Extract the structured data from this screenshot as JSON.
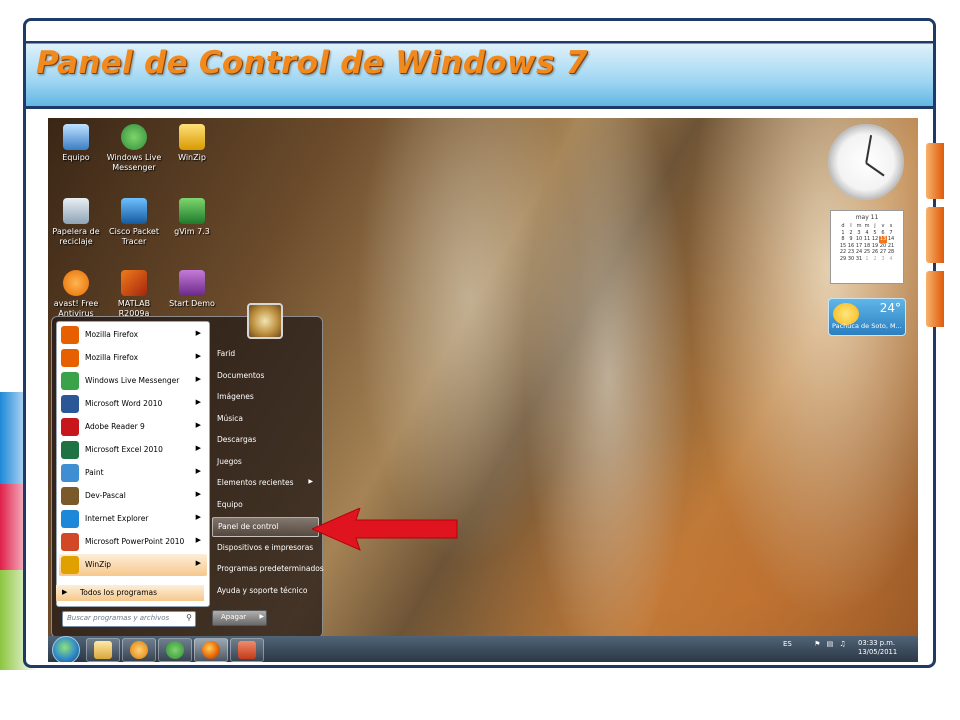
{
  "slide": {
    "title": "Panel de Control de Windows 7"
  },
  "desktop_icons": [
    {
      "label": "Equipo"
    },
    {
      "label": "Windows Live Messenger"
    },
    {
      "label": "WinZip"
    },
    {
      "label": "Papelera de reciclaje"
    },
    {
      "label": "Cisco Packet Tracer"
    },
    {
      "label": "gVim 7.3"
    },
    {
      "label": "avast! Free Antivirus"
    },
    {
      "label": "MATLAB R2009a"
    },
    {
      "label": "Start Demo"
    }
  ],
  "start_menu": {
    "programs": [
      {
        "label": "Mozilla Firefox",
        "icon": "firefox-icon",
        "color": "#e66000"
      },
      {
        "label": "Mozilla Firefox",
        "icon": "firefox-icon",
        "color": "#e66000"
      },
      {
        "label": "Windows Live Messenger",
        "icon": "messenger-icon",
        "color": "#3aa34a"
      },
      {
        "label": "Microsoft Word 2010",
        "icon": "word-icon",
        "color": "#2b5797"
      },
      {
        "label": "Adobe Reader 9",
        "icon": "adobe-reader-icon",
        "color": "#c8161d"
      },
      {
        "label": "Microsoft Excel 2010",
        "icon": "excel-icon",
        "color": "#1f7244"
      },
      {
        "label": "Paint",
        "icon": "paint-icon",
        "color": "#3d8fd1"
      },
      {
        "label": "Dev-Pascal",
        "icon": "dev-pascal-icon",
        "color": "#7a5a2a"
      },
      {
        "label": "Internet Explorer",
        "icon": "internet-explorer-icon",
        "color": "#1e88d8"
      },
      {
        "label": "Microsoft PowerPoint 2010",
        "icon": "powerpoint-icon",
        "color": "#d24726"
      },
      {
        "label": "WinZip",
        "icon": "winzip-icon",
        "color": "#e0a000"
      }
    ],
    "all_programs": "Todos los programas",
    "search_placeholder": "Buscar programas y archivos",
    "right_items": [
      {
        "label": "Farid",
        "arrow": false
      },
      {
        "label": "Documentos",
        "arrow": false
      },
      {
        "label": "Imágenes",
        "arrow": false
      },
      {
        "label": "Música",
        "arrow": false
      },
      {
        "label": "Descargas",
        "arrow": false
      },
      {
        "label": "Juegos",
        "arrow": false
      },
      {
        "label": "Elementos recientes",
        "arrow": true
      },
      {
        "label": "Equipo",
        "arrow": false
      },
      {
        "label": "Panel de control",
        "arrow": false
      },
      {
        "label": "Dispositivos e impresoras",
        "arrow": false
      },
      {
        "label": "Programas predeterminados",
        "arrow": false
      },
      {
        "label": "Ayuda y soporte técnico",
        "arrow": false
      }
    ],
    "shutdown_label": "Apagar"
  },
  "gadgets": {
    "calendar_month": "may 11",
    "calendar_weekdays": [
      "d",
      "l",
      "m",
      "m",
      "j",
      "v",
      "s"
    ],
    "calendar_weeks": [
      [
        "1",
        "2",
        "3",
        "4",
        "5",
        "6",
        "7"
      ],
      [
        "8",
        "9",
        "10",
        "11",
        "12",
        "13",
        "14"
      ],
      [
        "15",
        "16",
        "17",
        "18",
        "19",
        "20",
        "21"
      ],
      [
        "22",
        "23",
        "24",
        "25",
        "26",
        "27",
        "28"
      ],
      [
        "29",
        "30",
        "31",
        "1",
        "2",
        "3",
        "4"
      ]
    ],
    "calendar_today": "13",
    "weather_temp": "24°",
    "weather_location": "Pachuca de Soto, M..."
  },
  "taskbar": {
    "language": "ES",
    "time": "03:33 p.m.",
    "date": "13/05/2011"
  },
  "colors": {
    "title_orange": "#f08a1e",
    "frame_navy": "#1f3a66",
    "arrow_red": "#e0141e"
  }
}
